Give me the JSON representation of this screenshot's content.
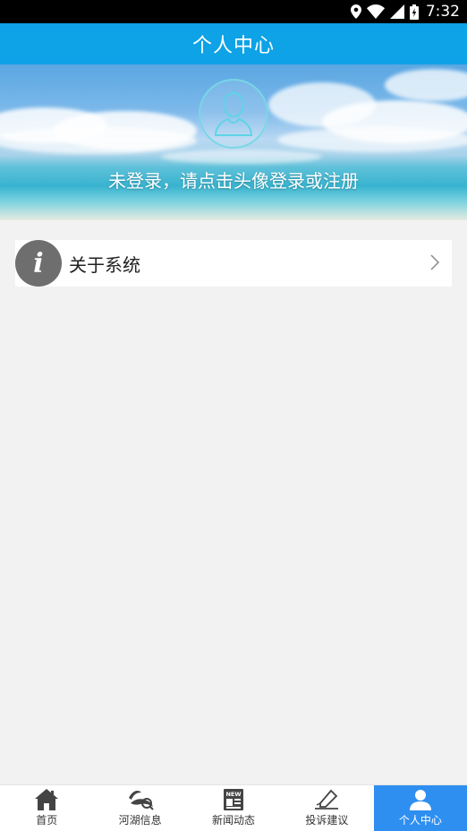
{
  "status_bar": {
    "time": "7:32"
  },
  "header": {
    "title": "个人中心"
  },
  "profile": {
    "login_prompt": "未登录，请点击头像登录或注册"
  },
  "menu": [
    {
      "icon": "info-icon",
      "label": "关于系统"
    }
  ],
  "tab_bar": {
    "items": [
      {
        "label": "首页",
        "icon": "home-icon"
      },
      {
        "label": "河湖信息",
        "icon": "river-icon"
      },
      {
        "label": "新闻动态",
        "icon": "news-icon",
        "icon_text": "NEW"
      },
      {
        "label": "投诉建议",
        "icon": "complaint-icon"
      },
      {
        "label": "个人中心",
        "icon": "user-icon",
        "active": true
      }
    ]
  },
  "colors": {
    "header": "#0ea2e6",
    "active_tab": "#2e8ff0",
    "background": "#f2f2f2"
  }
}
